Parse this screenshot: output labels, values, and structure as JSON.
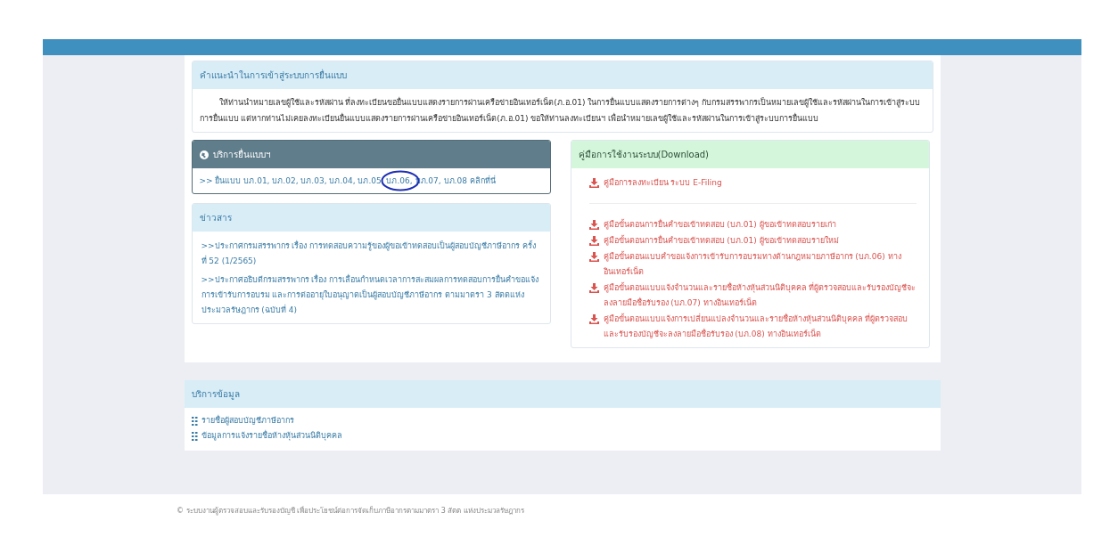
{
  "guide": {
    "title": "คำแนะนำในการเข้าสู่ระบบการยื่นแบบ",
    "text": "ให้ท่านนำหมายเลขผู้ใช้และรหัสผ่าน ที่ลงทะเบียนขอยื่นแบบแสดงรายการผ่านเครือข่ายอินเทอร์เน็ต(ภ.อ.01) ในการยื่นแบบแสดงรายการต่างๆ กับกรมสรรพากรเป็นหมายเลขผู้ใช้และรหัสผ่านในการเข้าสู่ระบบการยื่นแบบ แต่หากท่านไม่เคยลงทะเบียนยื่นแบบแสดงรายการผ่านเครือข่ายอินเทอร์เน็ต(ภ.อ.01) ขอให้ท่านลงทะเบียนฯ เพื่อนำหมายเลขผู้ใช้และรหัสผ่านในการเข้าสู่ระบบการยื่นแบบ"
  },
  "filing": {
    "title": "บริการยื่นแบบฯ",
    "link": ">> ยื่นแบบ บภ.01, บภ.02, บภ.03, บภ.04, บภ.05, บภ.06, บภ.07, บภ.08 คลิกที่นี่"
  },
  "news": {
    "title": "ข่าวสาร",
    "items": [
      ">>ประกาศกรมสรรพากร เรื่อง การทดสอบความรู้ของผู้ขอเข้าทดสอบเป็นผู้สอบบัญชีภาษีอากร ครั้งที่ 52 (1/2565)",
      ">>ประกาศอธิบดีกรมสรรพากร เรื่อง การเลื่อนกำหนดเวลาการสะสมผลการทดสอบการยื่นคำขอแจ้งการเข้ารับการอบรม และการต่ออายุใบอนุญาตเป็นผู้สอบบัญชีภาษีอากร ตามมาตรา 3 สัตตแห่งประมวลรัษฎากร (ฉบับที่ 4)"
    ]
  },
  "manuals": {
    "title": "คู่มือการใช้งานระบบ(Download)",
    "items": [
      {
        "label": "คู่มือการลงทะเบียน ระบบ E-Filing",
        "separated": true
      },
      {
        "label": "คู่มือขั้นตอนการยื่นคำขอเข้าทดสอบ (บภ.01) ผู้ขอเข้าทดสอบรายเก่า",
        "separated": false
      },
      {
        "label": "คู่มือขั้นตอนการยื่นคำขอเข้าทดสอบ (บภ.01) ผู้ขอเข้าทดสอบรายใหม่",
        "separated": false
      },
      {
        "label": "คู่มือขั้นตอนแบบคำขอแจ้งการเข้ารับการอบรมทางด้านกฎหมายภาษีอากร (บภ.06) ทางอินเทอร์เน็ต",
        "separated": false
      },
      {
        "label": "คู่มือขั้นตอนแบบแจ้งจำนวนและรายชื่อห้างหุ้นส่วนนิติบุคคล ที่ผู้ตรวจสอบและรับรองบัญชีจะลงลายมือชื่อรับรอง (บภ.07) ทางอินเทอร์เน็ต",
        "separated": false
      },
      {
        "label": "คู่มือขั้นตอนแบบแจ้งการเปลี่ยนแปลงจำนวนและรายชื่อห้างหุ้นส่วนนิติบุคคล ที่ผู้ตรวจสอบและรับรองบัญชีจะลงลายมือชื่อรับรอง (บภ.08) ทางอินเทอร์เน็ต",
        "separated": false
      }
    ]
  },
  "data_services": {
    "title": "บริการข้อมูล",
    "items": [
      "รายชื่อผู้สอบบัญชีภาษีอากร",
      "ข้อมูลการแจ้งรายชื่อห้างหุ้นส่วนนิติบุคคล"
    ]
  },
  "footer": "© ระบบงานผู้ตรวจสอบและรับรองบัญชี เพื่อประโยชน์ต่อการจัดเก็บภาษีอากรตามมาตรา 3 สัตต แห่งประมวลรัษฎากร"
}
